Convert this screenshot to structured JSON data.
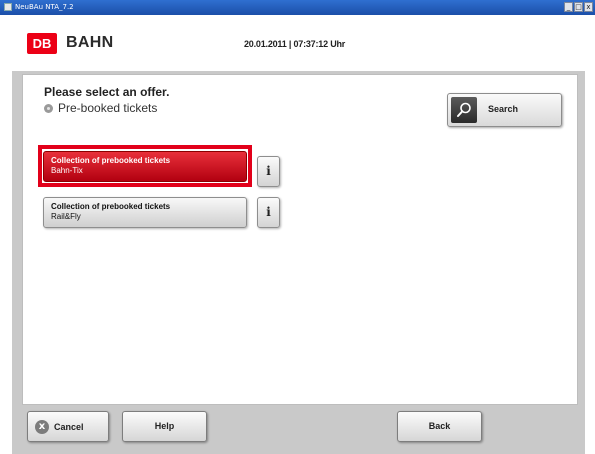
{
  "window": {
    "title": "NeuBAu NTA_7.2",
    "controls": [
      "_",
      "□",
      "x"
    ]
  },
  "header": {
    "logo_text": "DB",
    "brand": "BAHN",
    "datetime": "20.01.2011 | 07:37:12 Uhr",
    "brand_color": "#ec0016"
  },
  "main": {
    "heading": "Please select an offer.",
    "subheading": "Pre-booked tickets",
    "search_label": "Search",
    "offers": [
      {
        "title": "Collection of prebooked tickets",
        "subtitle": "Bahn-Tix",
        "selected": true
      },
      {
        "title": "Collection of prebooked tickets",
        "subtitle": "Rail&Fly",
        "selected": false
      }
    ],
    "info_label": "i"
  },
  "footer": {
    "cancel_icon": "x",
    "cancel_label": "Cancel",
    "help_label": "Help",
    "back_label": "Back"
  },
  "icons": {
    "search": "magnifier-icon",
    "cancel": "close-circle-icon",
    "info": "info-icon"
  }
}
